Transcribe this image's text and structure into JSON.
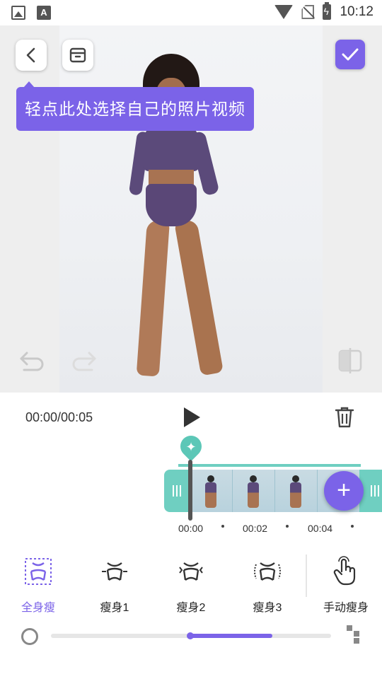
{
  "status_bar": {
    "time": "10:12",
    "notif_a": "A"
  },
  "editor": {
    "tooltip": "轻点此处选择自己的照片视频",
    "time_display": "00:00/00:05"
  },
  "timeline": {
    "keyframe_symbol": "✦",
    "add_symbol": "+",
    "timestamps": [
      "00:00",
      "00:02",
      "00:04"
    ]
  },
  "tools": {
    "items": [
      {
        "label": "全身瘦",
        "icon": "full-body-slim-icon",
        "active": true
      },
      {
        "label": "瘦身1",
        "icon": "slim-1-icon",
        "active": false
      },
      {
        "label": "瘦身2",
        "icon": "slim-2-icon",
        "active": false
      },
      {
        "label": "瘦身3",
        "icon": "slim-3-icon",
        "active": false
      },
      {
        "label": "手动瘦身",
        "icon": "manual-slim-hand-icon",
        "active": false
      }
    ]
  },
  "slider": {
    "value_fraction": 0.5
  },
  "colors": {
    "accent": "#7b63e8",
    "teal": "#6fcfc1"
  }
}
